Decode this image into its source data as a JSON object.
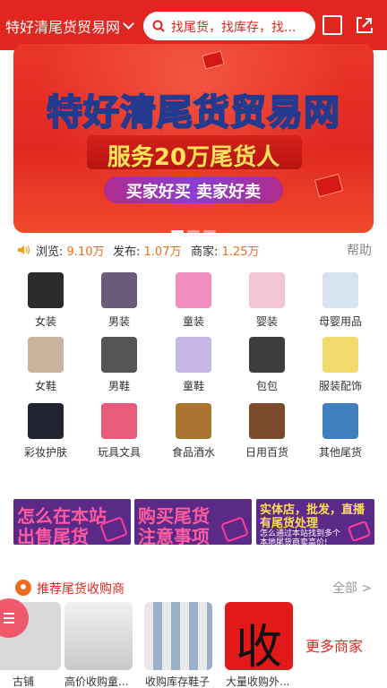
{
  "header": {
    "site_name": "特好清尾货贸易网",
    "search_placeholder": "找尾货，找库存，找..."
  },
  "banner": {
    "title": "特好清尾货贸易网",
    "subtitle": "服务20万尾货人",
    "tagline": "买家好买 卖家好卖"
  },
  "stats": {
    "views_label": "浏览:",
    "views_value": "9.10万",
    "posts_label": "发布:",
    "posts_value": "1.07万",
    "merchants_label": "商家:",
    "merchants_value": "1.25万",
    "help": "帮助"
  },
  "categories": [
    {
      "label": "女装",
      "icon": "womens-clothing-icon",
      "color": "#2b2b2b"
    },
    {
      "label": "男装",
      "icon": "mens-clothing-icon",
      "color": "#6b5a7a"
    },
    {
      "label": "童装",
      "icon": "kids-clothing-icon",
      "color": "#f08fbf"
    },
    {
      "label": "婴装",
      "icon": "baby-clothing-icon",
      "color": "#f2c6d6"
    },
    {
      "label": "母婴用品",
      "icon": "maternity-baby-icon",
      "color": "#d7e3f0"
    },
    {
      "label": "女鞋",
      "icon": "womens-shoes-icon",
      "color": "#c9b39c"
    },
    {
      "label": "男鞋",
      "icon": "mens-shoes-icon",
      "color": "#555555"
    },
    {
      "label": "童鞋",
      "icon": "kids-shoes-icon",
      "color": "#c7b5e6"
    },
    {
      "label": "包包",
      "icon": "bag-icon",
      "color": "#3d3d3d"
    },
    {
      "label": "服装配饰",
      "icon": "accessories-icon",
      "color": "#f3d86b"
    },
    {
      "label": "彩妆护肤",
      "icon": "cosmetics-icon",
      "color": "#1f2430"
    },
    {
      "label": "玩具文具",
      "icon": "toys-stationery-icon",
      "color": "#e85b7a"
    },
    {
      "label": "食品酒水",
      "icon": "food-drinks-icon",
      "color": "#a8742f"
    },
    {
      "label": "日用百货",
      "icon": "daily-goods-icon",
      "color": "#7a4a2a"
    },
    {
      "label": "其他尾货",
      "icon": "other-goods-icon",
      "color": "#3d7fbf"
    }
  ],
  "ads": {
    "ad1_line1": "怎么在本站",
    "ad1_line2": "出售尾货",
    "ad2_line1": "购买尾货",
    "ad2_line2": "注意事项",
    "ad3_line1": "实体店，批发，直播",
    "ad3_line2": "有尾货处理",
    "ad3_line3": "怎么通过本站找到多个",
    "ad3_line4": "本地尾货商卖高价!"
  },
  "recommend": {
    "title": "推荐尾货收购商",
    "all": "全部 >",
    "items": [
      {
        "name": "古铺"
      },
      {
        "name": "高价收购童..."
      },
      {
        "name": "收购库存鞋子"
      },
      {
        "name": "大量收购外...",
        "logo_char": "收"
      }
    ],
    "more": "更多商家"
  },
  "colors": {
    "brand_red": "#e0261f",
    "stat_orange": "#ef6b19"
  }
}
